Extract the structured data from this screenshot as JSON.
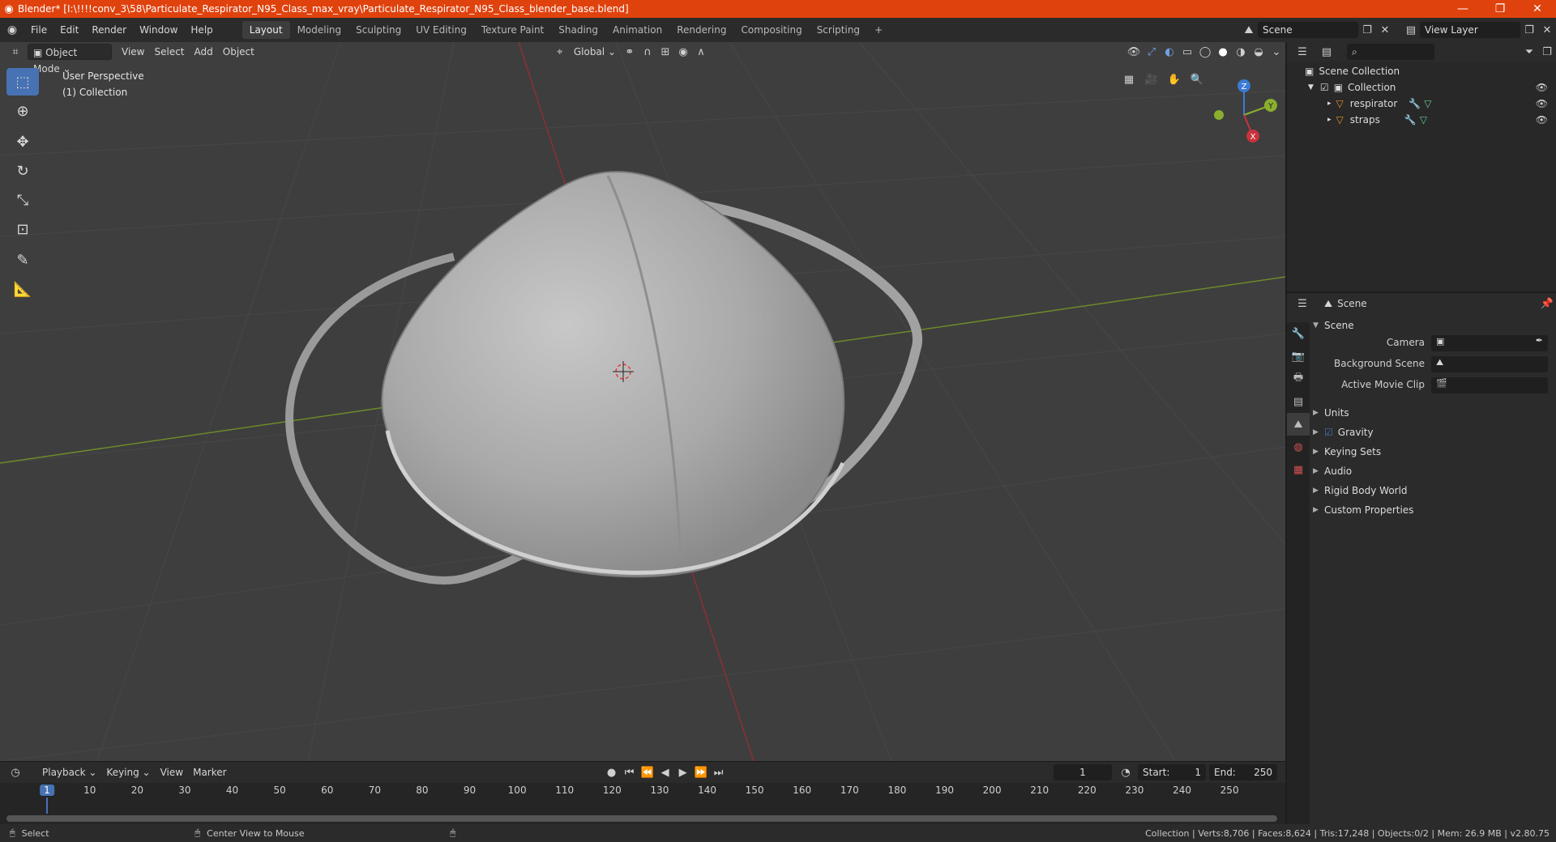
{
  "title_bar": {
    "title": "Blender* [I:\\!!!!conv_3\\58\\Particulate_Respirator_N95_Class_max_vray\\Particulate_Respirator_N95_Class_blender_base.blend]"
  },
  "menu": [
    "File",
    "Edit",
    "Render",
    "Window",
    "Help"
  ],
  "workspaces": [
    "Layout",
    "Modeling",
    "Sculpting",
    "UV Editing",
    "Texture Paint",
    "Shading",
    "Animation",
    "Rendering",
    "Compositing",
    "Scripting"
  ],
  "active_workspace": "Layout",
  "scene_field": "Scene",
  "view_layer_field": "View Layer",
  "viewport": {
    "mode": "Object Mode",
    "menus": [
      "View",
      "Select",
      "Add",
      "Object"
    ],
    "transform_orientation": "Global",
    "overlay_line1": "User Perspective",
    "overlay_line2": "(1) Collection",
    "gizmo_axes": {
      "x": "X",
      "y": "Y",
      "z": "Z"
    }
  },
  "outliner": {
    "root": "Scene Collection",
    "collection": "Collection",
    "objects": [
      "respirator",
      "straps"
    ]
  },
  "properties": {
    "context": "Scene",
    "panel_title": "Scene",
    "fields": {
      "camera_label": "Camera",
      "background_scene_label": "Background Scene",
      "active_movie_clip_label": "Active Movie Clip"
    },
    "sections": [
      "Units",
      "Gravity",
      "Keying Sets",
      "Audio",
      "Rigid Body World",
      "Custom Properties"
    ]
  },
  "timeline": {
    "menus": [
      "Playback",
      "Keying",
      "View",
      "Marker"
    ],
    "current_frame": "1",
    "start_label": "Start:",
    "start": "1",
    "end_label": "End:",
    "end": "250",
    "ruler": [
      "1",
      "10",
      "20",
      "30",
      "40",
      "50",
      "60",
      "70",
      "80",
      "90",
      "100",
      "110",
      "120",
      "130",
      "140",
      "150",
      "160",
      "170",
      "180",
      "190",
      "200",
      "210",
      "220",
      "230",
      "240",
      "250"
    ]
  },
  "status": {
    "left": "Select",
    "middle": "Center View to Mouse",
    "right": "Collection | Verts:8,706 | Faces:8,624 | Tris:17,248 | Objects:0/2 | Mem: 26.9 MB | v2.80.75"
  },
  "colors": {
    "titlebar": "#e0420e",
    "accent_blue": "#4772b3",
    "x_axis": "#c8333d",
    "y_axis": "#8aaf2e",
    "z_axis": "#3a7bd5",
    "object_orange": "#e8902e"
  }
}
